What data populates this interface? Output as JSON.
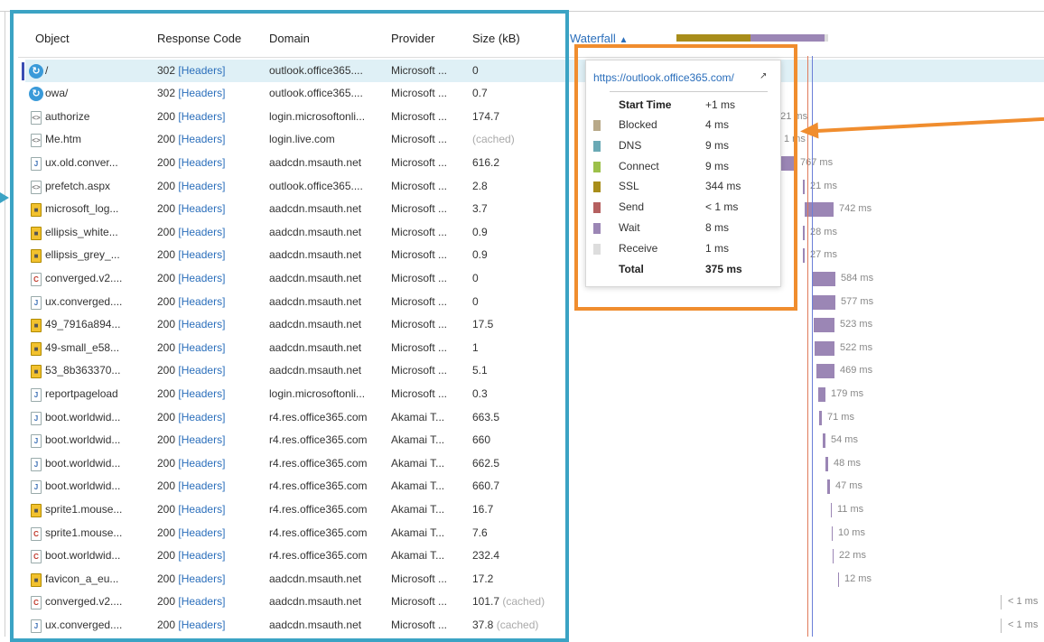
{
  "columns": {
    "object": "Object",
    "response_code": "Response Code",
    "domain": "Domain",
    "provider": "Provider",
    "size": "Size (kB)",
    "waterfall": "Waterfall",
    "sort_icon": "triangle-up-icon"
  },
  "rows": [
    {
      "icon": "redirect",
      "object": "/",
      "code": "302",
      "headers": "[Headers]",
      "domain": "outlook.office365....",
      "provider": "Microsoft ...",
      "size": "0",
      "cached": "",
      "wf": "",
      "selected": true
    },
    {
      "icon": "redirect",
      "object": "owa/",
      "code": "302",
      "headers": "[Headers]",
      "domain": "outlook.office365....",
      "provider": "Microsoft ...",
      "size": "0.7",
      "cached": "",
      "wf": ""
    },
    {
      "icon": "html",
      "object": "authorize",
      "code": "200",
      "headers": "[Headers]",
      "domain": "login.microsoftonli...",
      "provider": "Microsoft ...",
      "size": "174.7",
      "cached": "",
      "wf": "321 ms"
    },
    {
      "icon": "html",
      "object": "Me.htm",
      "code": "200",
      "headers": "[Headers]",
      "domain": "login.live.com",
      "provider": "Microsoft ...",
      "size": "",
      "cached": "(cached)",
      "wf": "1 ms"
    },
    {
      "icon": "js",
      "object": "ux.old.conver...",
      "code": "200",
      "headers": "[Headers]",
      "domain": "aadcdn.msauth.net",
      "provider": "Microsoft ...",
      "size": "616.2",
      "cached": "",
      "wf": "767 ms"
    },
    {
      "icon": "html",
      "object": "prefetch.aspx",
      "code": "200",
      "headers": "[Headers]",
      "domain": "outlook.office365....",
      "provider": "Microsoft ...",
      "size": "2.8",
      "cached": "",
      "wf": "21 ms"
    },
    {
      "icon": "img",
      "object": "microsoft_log...",
      "code": "200",
      "headers": "[Headers]",
      "domain": "aadcdn.msauth.net",
      "provider": "Microsoft ...",
      "size": "3.7",
      "cached": "",
      "wf": "742 ms"
    },
    {
      "icon": "img",
      "object": "ellipsis_white...",
      "code": "200",
      "headers": "[Headers]",
      "domain": "aadcdn.msauth.net",
      "provider": "Microsoft ...",
      "size": "0.9",
      "cached": "",
      "wf": "28 ms"
    },
    {
      "icon": "img",
      "object": "ellipsis_grey_...",
      "code": "200",
      "headers": "[Headers]",
      "domain": "aadcdn.msauth.net",
      "provider": "Microsoft ...",
      "size": "0.9",
      "cached": "",
      "wf": "27 ms"
    },
    {
      "icon": "css",
      "object": "converged.v2....",
      "code": "200",
      "headers": "[Headers]",
      "domain": "aadcdn.msauth.net",
      "provider": "Microsoft ...",
      "size": "0",
      "cached": "",
      "wf": "584 ms"
    },
    {
      "icon": "js",
      "object": "ux.converged....",
      "code": "200",
      "headers": "[Headers]",
      "domain": "aadcdn.msauth.net",
      "provider": "Microsoft ...",
      "size": "0",
      "cached": "",
      "wf": "577 ms"
    },
    {
      "icon": "img",
      "object": "49_7916a894...",
      "code": "200",
      "headers": "[Headers]",
      "domain": "aadcdn.msauth.net",
      "provider": "Microsoft ...",
      "size": "17.5",
      "cached": "",
      "wf": "523 ms"
    },
    {
      "icon": "img",
      "object": "49-small_e58...",
      "code": "200",
      "headers": "[Headers]",
      "domain": "aadcdn.msauth.net",
      "provider": "Microsoft ...",
      "size": "1",
      "cached": "",
      "wf": "522 ms"
    },
    {
      "icon": "img",
      "object": "53_8b363370...",
      "code": "200",
      "headers": "[Headers]",
      "domain": "aadcdn.msauth.net",
      "provider": "Microsoft ...",
      "size": "5.1",
      "cached": "",
      "wf": "469 ms"
    },
    {
      "icon": "js",
      "object": "reportpageload",
      "code": "200",
      "headers": "[Headers]",
      "domain": "login.microsoftonli...",
      "provider": "Microsoft ...",
      "size": "0.3",
      "cached": "",
      "wf": "179 ms"
    },
    {
      "icon": "js",
      "object": "boot.worldwid...",
      "code": "200",
      "headers": "[Headers]",
      "domain": "r4.res.office365.com",
      "provider": "Akamai T...",
      "size": "663.5",
      "cached": "",
      "wf": "71 ms"
    },
    {
      "icon": "js",
      "object": "boot.worldwid...",
      "code": "200",
      "headers": "[Headers]",
      "domain": "r4.res.office365.com",
      "provider": "Akamai T...",
      "size": "660",
      "cached": "",
      "wf": "54 ms"
    },
    {
      "icon": "js",
      "object": "boot.worldwid...",
      "code": "200",
      "headers": "[Headers]",
      "domain": "r4.res.office365.com",
      "provider": "Akamai T...",
      "size": "662.5",
      "cached": "",
      "wf": "48 ms"
    },
    {
      "icon": "js",
      "object": "boot.worldwid...",
      "code": "200",
      "headers": "[Headers]",
      "domain": "r4.res.office365.com",
      "provider": "Akamai T...",
      "size": "660.7",
      "cached": "",
      "wf": "47 ms"
    },
    {
      "icon": "img",
      "object": "sprite1.mouse...",
      "code": "200",
      "headers": "[Headers]",
      "domain": "r4.res.office365.com",
      "provider": "Akamai T...",
      "size": "16.7",
      "cached": "",
      "wf": "11 ms"
    },
    {
      "icon": "css",
      "object": "sprite1.mouse...",
      "code": "200",
      "headers": "[Headers]",
      "domain": "r4.res.office365.com",
      "provider": "Akamai T...",
      "size": "7.6",
      "cached": "",
      "wf": "10 ms"
    },
    {
      "icon": "css",
      "object": "boot.worldwid...",
      "code": "200",
      "headers": "[Headers]",
      "domain": "r4.res.office365.com",
      "provider": "Akamai T...",
      "size": "232.4",
      "cached": "",
      "wf": "22 ms"
    },
    {
      "icon": "img",
      "object": "favicon_a_eu...",
      "code": "200",
      "headers": "[Headers]",
      "domain": "aadcdn.msauth.net",
      "provider": "Microsoft ...",
      "size": "17.2",
      "cached": "",
      "wf": "12 ms"
    },
    {
      "icon": "css",
      "object": "converged.v2....",
      "code": "200",
      "headers": "[Headers]",
      "domain": "aadcdn.msauth.net",
      "provider": "Microsoft ...",
      "size": "101.7",
      "cached": "(cached)",
      "wf": "< 1 ms"
    },
    {
      "icon": "js",
      "object": "ux.converged....",
      "code": "200",
      "headers": "[Headers]",
      "domain": "aadcdn.msauth.net",
      "provider": "Microsoft ...",
      "size": "37.8",
      "cached": "(cached)",
      "wf": "< 1 ms"
    }
  ],
  "tooltip": {
    "url": "https://outlook.office365.com/",
    "external_icon": "external-link-icon",
    "start_label": "Start Time",
    "start_value": "+1 ms",
    "phases": [
      {
        "label": "Blocked",
        "value": "4 ms",
        "color": "#b8a989"
      },
      {
        "label": "DNS",
        "value": "9 ms",
        "color": "#6aa9b5"
      },
      {
        "label": "Connect",
        "value": "9 ms",
        "color": "#9cc04a"
      },
      {
        "label": "SSL",
        "value": "344 ms",
        "color": "#a88d1a"
      },
      {
        "label": "Send",
        "value": "< 1 ms",
        "color": "#b56060"
      },
      {
        "label": "Wait",
        "value": "8 ms",
        "color": "#9b86b5"
      },
      {
        "label": "Receive",
        "value": "1 ms",
        "color": "#dddddd"
      }
    ],
    "total_label": "Total",
    "total_value": "375 ms"
  },
  "colors": {
    "annotation_blue": "#3ba3c4",
    "annotation_orange": "#f08d2e",
    "wait_bar": "#9b86b5",
    "link": "#2a6ebb"
  }
}
